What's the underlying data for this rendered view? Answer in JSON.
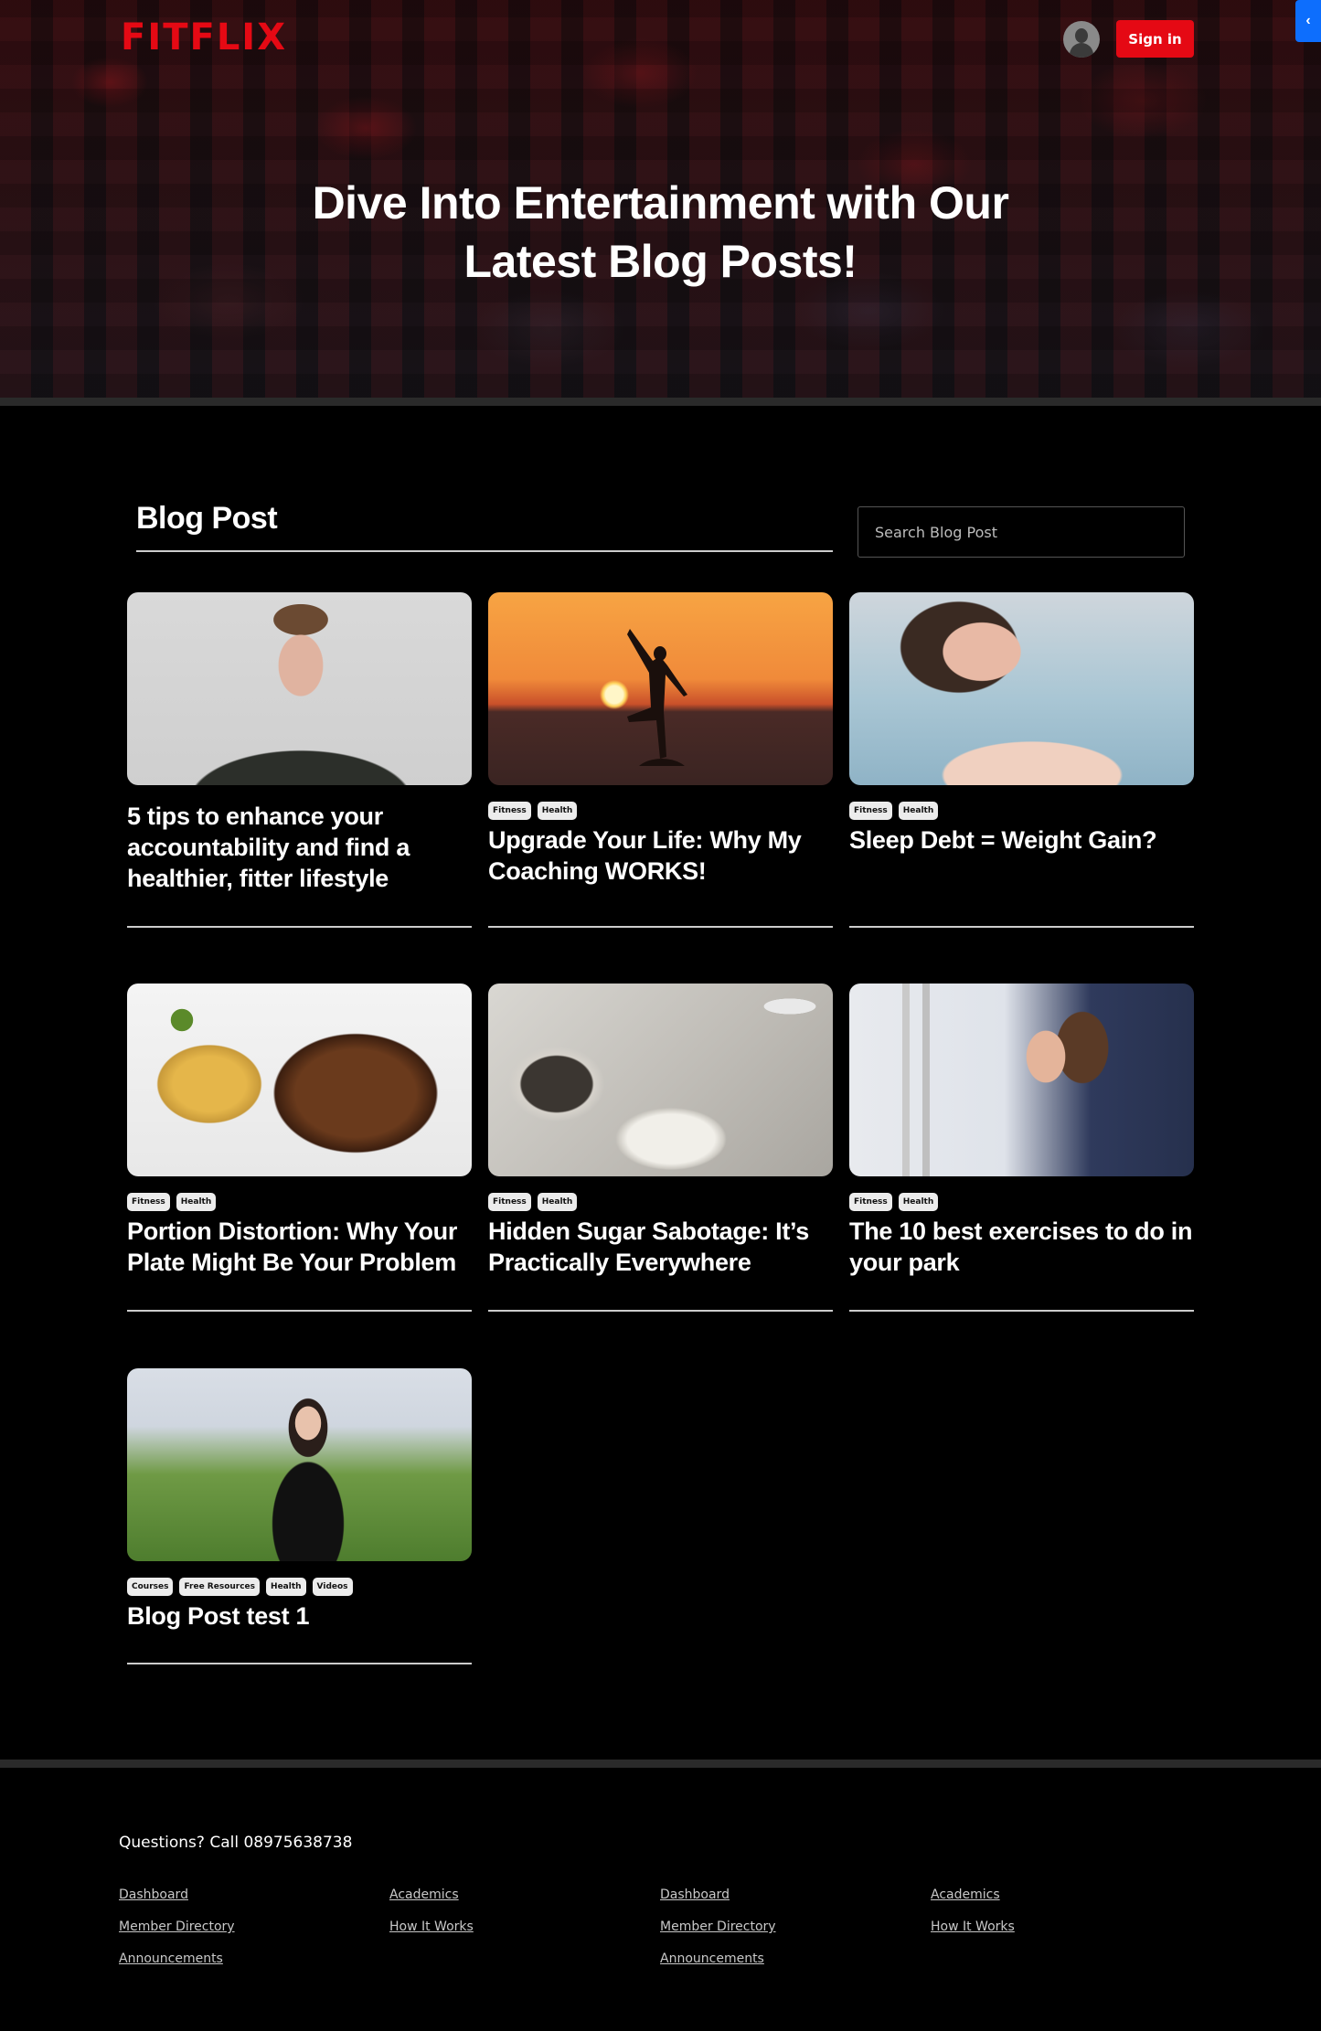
{
  "header": {
    "logo": "FITFLIX",
    "signin_label": "Sign in",
    "side_toggle_icon": "‹",
    "brand_color": "#e50914",
    "toggle_color": "#0d6efd"
  },
  "hero": {
    "title_line1": "Dive Into Entertainment with Our",
    "title_line2": "Latest Blog Posts!"
  },
  "blog": {
    "heading": "Blog Post",
    "search_placeholder": "Search Blog Post",
    "posts": [
      {
        "title": "5 tips to enhance your accountability and find a healthier, fitter lifestyle",
        "tags": [],
        "image": "man-portrait"
      },
      {
        "title": "Upgrade Your Life: Why My Coaching WORKS!",
        "tags": [
          "Fitness",
          "Health"
        ],
        "image": "sunset-silhouette"
      },
      {
        "title": "Sleep Debt = Weight Gain?",
        "tags": [
          "Fitness",
          "Health"
        ],
        "image": "woman-sleeping"
      },
      {
        "title": "Portion Distortion: Why Your Plate Might Be Your Problem",
        "tags": [
          "Fitness",
          "Health"
        ],
        "image": "roast-chicken-plate"
      },
      {
        "title": "Hidden Sugar Sabotage: It’s Practically Everywhere",
        "tags": [
          "Fitness",
          "Health"
        ],
        "image": "sugar-spoon-cups"
      },
      {
        "title": "The 10 best exercises to do in your park",
        "tags": [
          "Fitness",
          "Health"
        ],
        "image": "woman-gym-machine"
      },
      {
        "title": "Blog Post test 1",
        "tags": [
          "Courses",
          "Free Resources",
          "Health",
          "Videos"
        ],
        "image": "woman-meditating"
      }
    ]
  },
  "footer": {
    "questions": "Questions? Call 08975638738",
    "columns": [
      [
        "Dashboard",
        "Member Directory",
        "Announcements"
      ],
      [
        "Academics",
        "How It Works"
      ],
      [
        "Dashboard",
        "Member Directory",
        "Announcements"
      ],
      [
        "Academics",
        "How It Works"
      ]
    ]
  }
}
